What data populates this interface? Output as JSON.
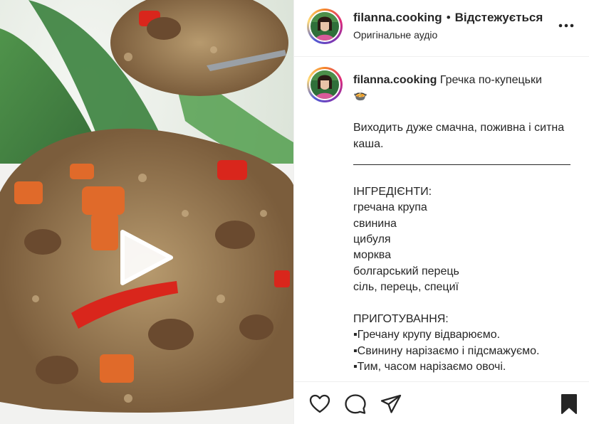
{
  "post": {
    "username": "filanna.cooking",
    "separator": "•",
    "follow_status": "Відстежується",
    "audio_label": "Оригінальне аудіо"
  },
  "caption": {
    "username": "filanna.cooking",
    "title": "Гречка по-купецьки",
    "emoji": "🍲",
    "intro": "Виходить дуже смачна, поживна і ситна каша.",
    "divider": "____________________________________________",
    "ingredients_heading": "ІНГРЕДІЄНТИ:",
    "ingredients": [
      "гречана крупа",
      "свинина",
      "цибуля",
      "морква",
      "болгарський перець",
      "сіль, перець, специї"
    ],
    "steps_heading": "ПРИГОТУВАННЯ:",
    "steps": [
      "▪Гречану крупу відварюємо.",
      "▪Свинину нарізаємо і підсмажуємо.",
      "▪Тим, часом нарізаємо овочі."
    ]
  },
  "icons": {
    "more": "more-options-icon",
    "like": "heart-icon",
    "comment": "comment-icon",
    "share": "send-icon",
    "save": "bookmark-icon",
    "play": "play-icon"
  },
  "colors": {
    "text": "#262626",
    "border": "#efefef",
    "ring_start": "#f58529",
    "ring_mid": "#dd2a7b",
    "ring_end": "#8134af"
  }
}
